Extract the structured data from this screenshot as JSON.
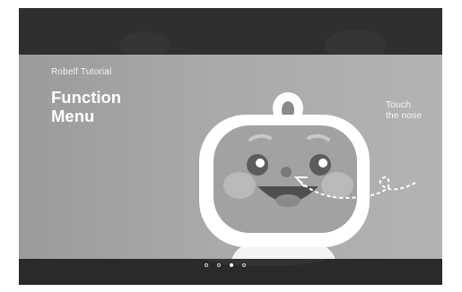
{
  "slide": {
    "eyebrow": "Robelf Tutorial",
    "title_line1": "Function",
    "title_line2": "Menu",
    "hint_line1": "Touch",
    "hint_line2": "the nose"
  },
  "pager": {
    "total": 4,
    "active_index": 2
  },
  "colors": {
    "frame": "#2d2d2d",
    "slide_bg": "#a9a9a9",
    "robot_face": "#ffffff",
    "text": "#ffffff"
  },
  "icons": [
    "robot-illustration",
    "dashed-arrow-icon"
  ]
}
